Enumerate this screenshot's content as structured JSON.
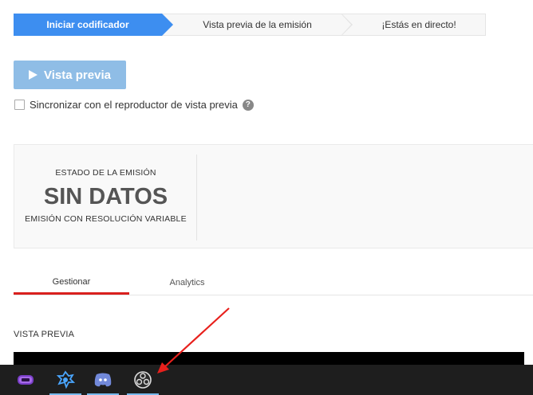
{
  "stepper": {
    "step1": "Iniciar codificador",
    "step2": "Vista previa de la emisión",
    "step3": "¡Estás en directo!"
  },
  "preview_button": {
    "label": "Vista previa",
    "icon": "play-icon"
  },
  "sync": {
    "label": "Sincronizar con el reproductor de vista previa",
    "checked": false,
    "help_glyph": "?"
  },
  "status": {
    "label": "ESTADO DE LA EMISIÓN",
    "value": "SIN DATOS",
    "sub": "EMISIÓN CON RESOLUCIÓN VARIABLE"
  },
  "tabs": [
    {
      "label": "Gestionar",
      "active": true
    },
    {
      "label": "Analytics",
      "active": false
    }
  ],
  "section_title": "VISTA PREVIA",
  "taskbar": {
    "apps": [
      {
        "icon": "gamepad-app-icon"
      },
      {
        "icon": "battle-app-icon"
      },
      {
        "icon": "discord-icon"
      },
      {
        "icon": "obs-icon"
      }
    ]
  },
  "colors": {
    "accent": "#3d8ef0",
    "button_disabled": "#8fbde6",
    "tab_indicator": "#d9201e",
    "arrow": "#e8201c",
    "taskbar": "#1e1e1e"
  }
}
